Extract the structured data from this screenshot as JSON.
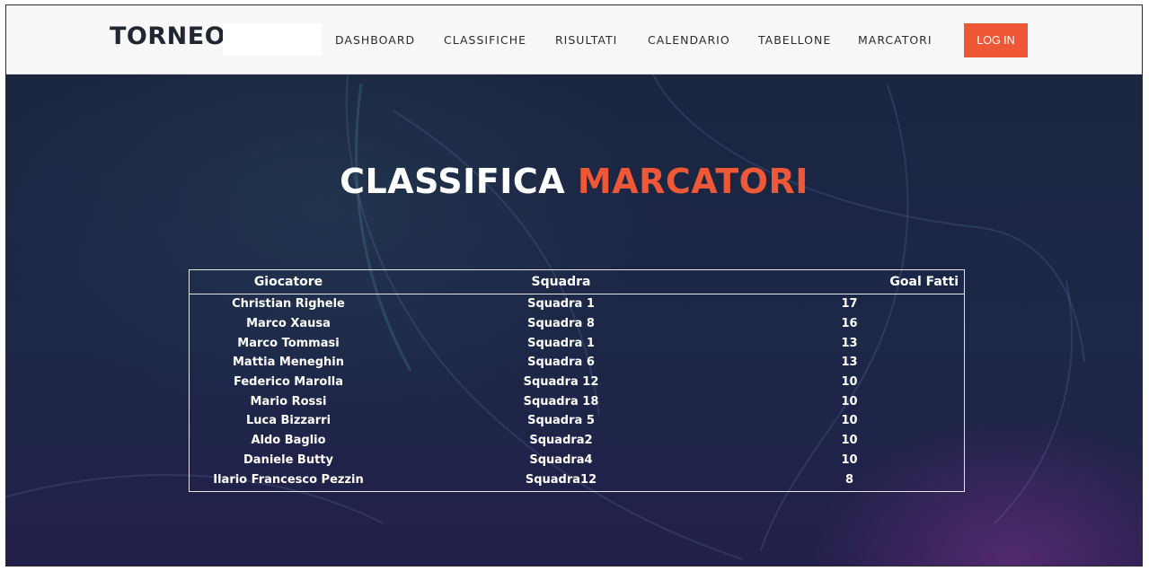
{
  "brand": {
    "logo": "TORNEO"
  },
  "nav": {
    "items": [
      "DASHBOARD",
      "CLASSIFICHE",
      "RISULTATI",
      "CALENDARIO",
      "TABELLONE",
      "MARCATORI"
    ],
    "login_label": "LOG IN"
  },
  "hero": {
    "title_part1": "CLASSIFICA",
    "title_part2": "MARCATORI"
  },
  "scorers_table": {
    "columns": [
      "Giocatore",
      "Squadra",
      "Goal Fatti"
    ],
    "rows": [
      [
        "Christian Righele",
        "Squadra 1",
        "17"
      ],
      [
        "Marco Xausa",
        "Squadra 8",
        "16"
      ],
      [
        "Marco Tommasi",
        "Squadra 1",
        "13"
      ],
      [
        "Mattia Meneghin",
        "Squadra 6",
        "13"
      ],
      [
        "Federico Marolla",
        "Squadra 12",
        "10"
      ],
      [
        "Mario Rossi",
        "Squadra 18",
        "10"
      ],
      [
        "Luca Bizzarri",
        "Squadra 5",
        "10"
      ],
      [
        "Aldo Baglio",
        "Squadra2",
        "10"
      ],
      [
        "Daniele Butty",
        "Squadra4",
        "10"
      ],
      [
        "Ilario Francesco Pezzin",
        "Squadra12",
        "8"
      ]
    ]
  },
  "colors": {
    "accent": "#ef5836",
    "navbar_bg": "#f8f8f8",
    "hero_bg": "#1d2748",
    "logo_text": "#1f2733"
  }
}
